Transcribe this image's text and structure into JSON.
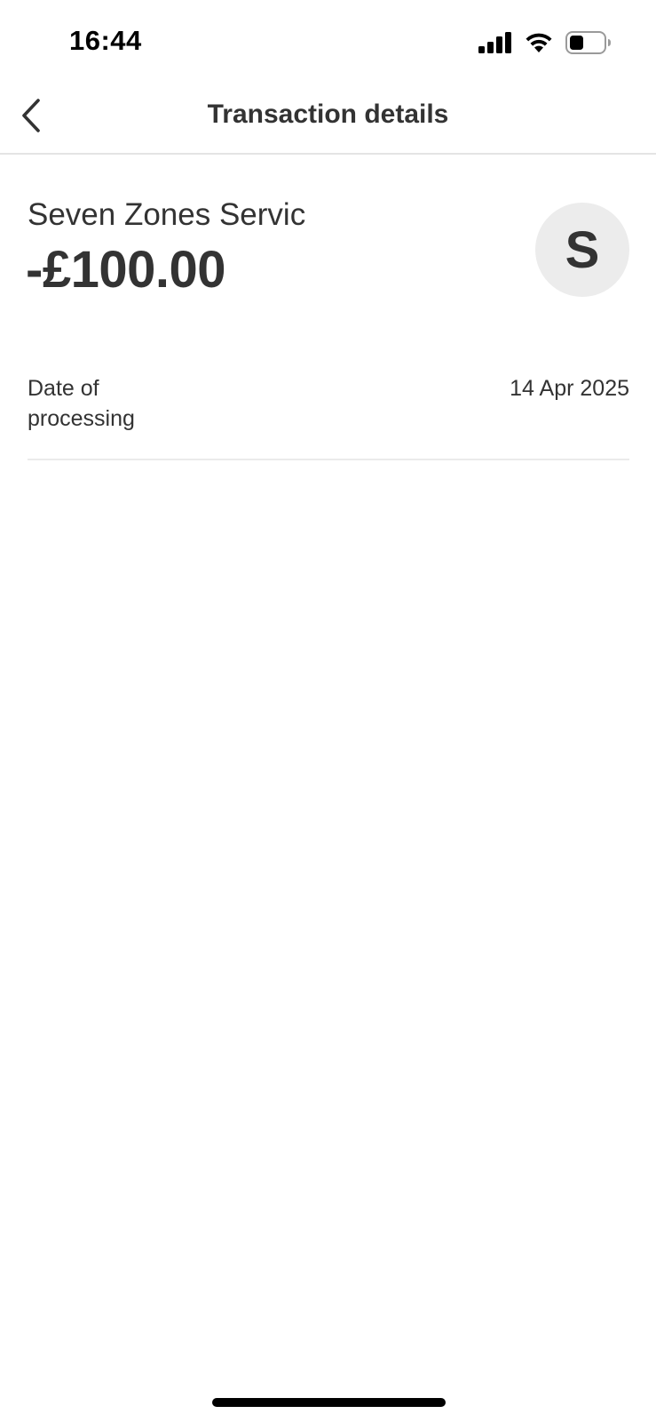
{
  "status_bar": {
    "time": "16:44",
    "icons": [
      "cellular-signal-icon",
      "wifi-icon",
      "battery-icon"
    ]
  },
  "nav": {
    "back_icon": "chevron-left-icon",
    "title": "Transaction details"
  },
  "transaction": {
    "merchant_name": "Seven Zones Servic",
    "amount": "-£100.00",
    "avatar_letter": "S",
    "avatar_color": "#ececec"
  },
  "details": [
    {
      "label": "Date of processing",
      "value": "14 Apr 2025"
    }
  ],
  "colors": {
    "text": "#333333",
    "background": "#ffffff",
    "divider": "#e4e4e4"
  }
}
